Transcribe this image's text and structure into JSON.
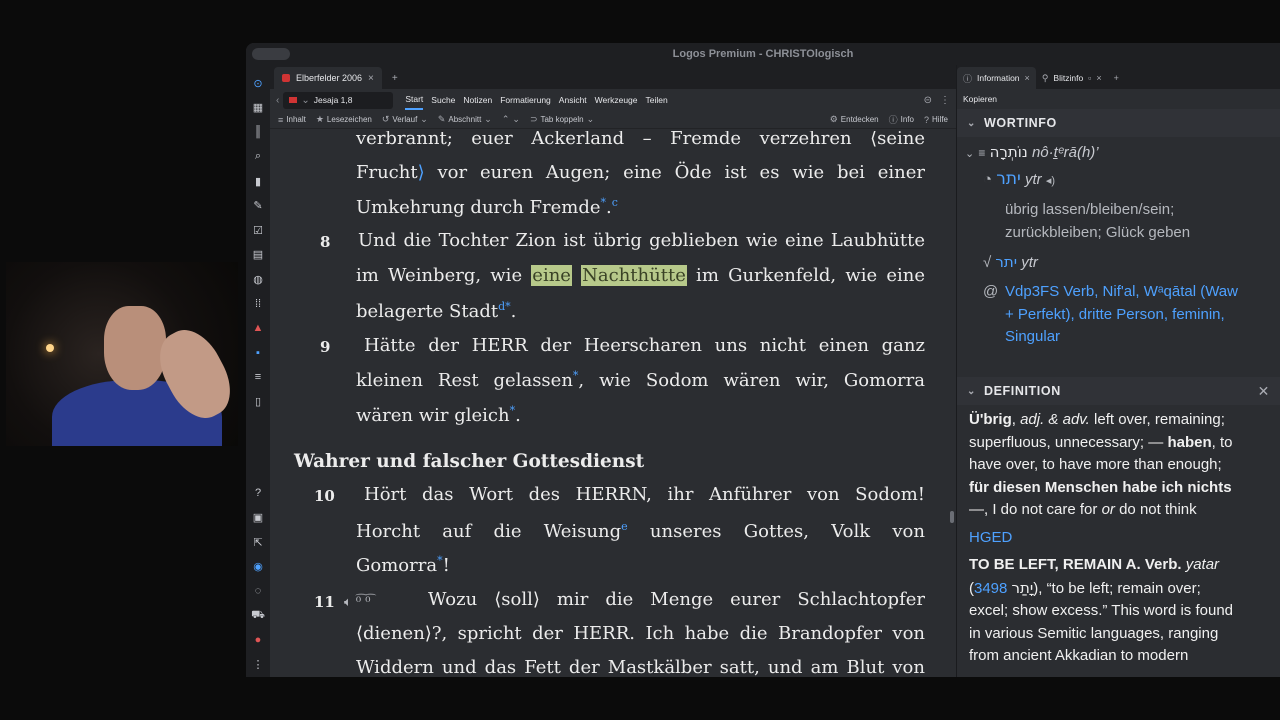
{
  "app": {
    "title": "Logos Premium - CHRISTOlogisch"
  },
  "doc_tab": {
    "label": "Elberfelder 2006",
    "close": "×",
    "add": "+"
  },
  "nav": {
    "reference": "Jesaja 1,8",
    "menu": [
      "Start",
      "Suche",
      "Notizen",
      "Formatierung",
      "Ansicht",
      "Werkzeuge",
      "Teilen"
    ],
    "active_menu": "Start"
  },
  "toolbar": {
    "inhalt": "Inhalt",
    "lesezeichen": "Lesezeichen",
    "verlauf": "Verlauf",
    "abschnitt": "Abschnitt",
    "tab_koppeln": "Tab koppeln",
    "entdecken": "Entdecken",
    "info": "Info",
    "hilfe": "Hilfe"
  },
  "bible_text": {
    "l1": "verbrannt; euer Ackerland – Fremde verzehren ⟨seine",
    "l2a": "Frucht",
    "l2b": " vor euren Augen; eine Öde ist es wie bei einer",
    "l3a": "Umkehrung durch Fremde",
    "l3sup": "*",
    "l3b": ".",
    "l3c": "c",
    "v8": "8",
    "l4": "Und die Tochter Zion ist übrig geblieben wie eine Laubhütte",
    "l5a": "im Weinberg, wie ",
    "l5hl1": "eine",
    "l5hl2": "Nachthütte",
    "l5b": " im Gurkenfeld, wie eine",
    "l6a": "belagerte Stadt",
    "l6sup": "d*",
    "l6b": ".",
    "v9": "9",
    "l7": "Hätte der HERR der Heerscharen uns nicht einen ganz",
    "l8a": "kleinen Rest gelassen",
    "l8sup": "*",
    "l8b": ", wie Sodom wären wir, Gomorra",
    "l9a": "wären wir gleich",
    "l9sup": "*",
    "l9b": ".",
    "heading": "Wahrer und falscher Gottesdienst",
    "v10": "10",
    "l10": "Hört das Wort des HERRN, ihr Anführer von Sodom!",
    "l11a": "Horcht auf die Weisung",
    "l11sup": "e",
    "l11b": " unseres Gottes, Volk von",
    "l12a": "Gomorra",
    "l12sup": "*",
    "l12b": "!",
    "v11": "11",
    "l13": "Wozu ⟨soll⟩ mir die Menge eurer Schlachtopfer",
    "l14": "⟨dienen⟩?, spricht der HERR. Ich habe die Brandopfer von",
    "l15": "Widdern und das Fett der Mastkälber satt, und am Blut von"
  },
  "info_panel": {
    "tab_information": "Information",
    "tab_blitzinfo": "Blitzinfo",
    "kopieren": "Kopieren",
    "wortinfo_title": "WORTINFO",
    "word_heb": "נוֹתְרָה",
    "word_translit": "nô·ṯᵉrā(h)’",
    "root_heb": "יתר",
    "root_translit": "ytr",
    "gloss1": "übrig lassen/bleiben/sein;",
    "gloss2": "zurückbleiben; Glück geben",
    "root2_heb": "יתר",
    "root2_translit": "ytr",
    "morph1": "Vdp3FS Verb, Nif'al, Wᵃqātal (Waw",
    "morph2": "+ Perfekt), dritte Person, feminin,",
    "morph3": "Singular",
    "definition_title": "DEFINITION",
    "def": {
      "head": "Ü'brig",
      "pos": "adj. & adv.",
      "d1": "left over, remaining;",
      "d2": "superfluous, unnecessary; —",
      "haben": "haben",
      "d3": ", to",
      "d4": "have over, to have more than enough;",
      "bold2": "für diesen Menschen habe ich nichts",
      "d5a": "—, I do not care for",
      "or": "or",
      "d5b": "do not think",
      "hged": "HGED",
      "tbl": "TO BE LEFT, REMAIN A. Verb.",
      "yatar": "yatar",
      "num": "3498",
      "heb2": "יָתַר",
      "d6": "), “to be left; remain over;",
      "d7": "excel; show excess.” This word is found",
      "d8": "in various Semitic languages, ranging",
      "d9": "from ancient Akkadian to modern"
    }
  },
  "colors": {
    "accent": "#4ea1ff",
    "highlight": "#b7c98a",
    "bg": "#2b2d31"
  }
}
